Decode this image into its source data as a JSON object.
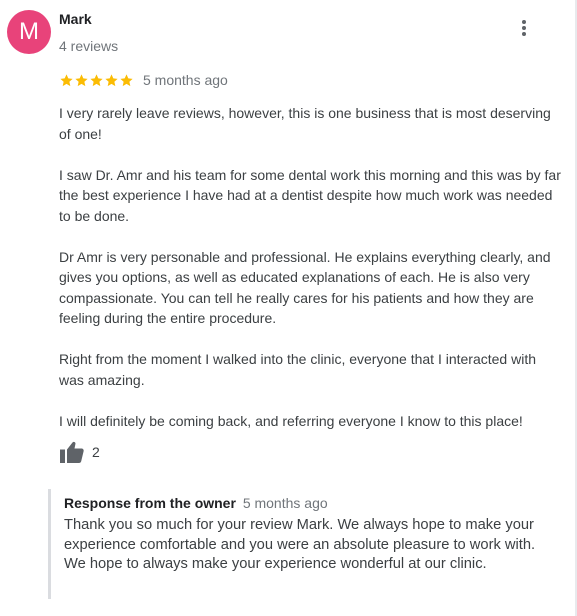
{
  "review": {
    "avatar_letter": "M",
    "avatar_color": "#e8437a",
    "reviewer_name": "Mark",
    "review_count": "4 reviews",
    "rating": 5,
    "star_color": "#fbbc04",
    "date": "5 months ago",
    "paragraphs": [
      "I very rarely leave reviews, however, this is one business that is most deserving of one!",
      "I saw Dr. Amr and his team for some dental work this morning and this was by far the best experience I have had at a dentist despite how much work was needed to be done.",
      "Dr Amr is very personable and professional. He explains everything clearly, and gives you options, as well as educated explanations of each. He is also very compassionate. You can tell he really cares for his patients and how they are feeling during the entire procedure.",
      "Right from the moment I walked into the clinic, everyone that I interacted with was amazing.",
      "I will definitely be coming back, and referring everyone I know to this place!"
    ],
    "like_count": "2",
    "icons": {
      "more": "more-vert-icon",
      "star": "star-icon",
      "like": "thumbs-up-icon"
    }
  },
  "owner_response": {
    "title": "Response from the owner",
    "date": "5 months ago",
    "text": "Thank you so much for your review Mark. We always hope to make your experience comfortable and you were an absolute pleasure to work with. We hope to always make your experience wonderful at our clinic."
  }
}
